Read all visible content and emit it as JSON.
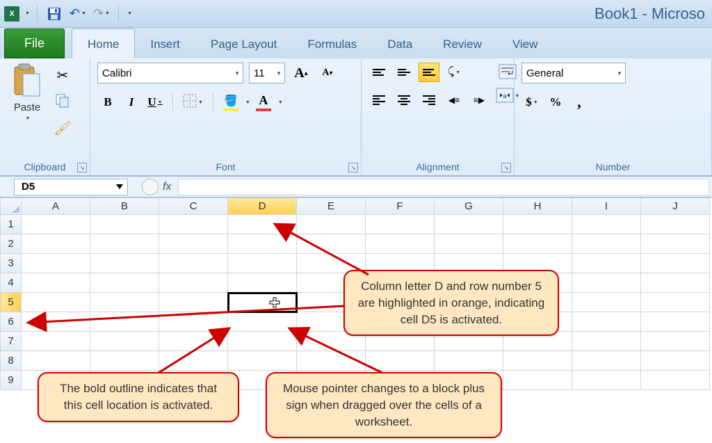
{
  "titlebar": {
    "title": "Book1 - Microso"
  },
  "tabs": {
    "file": "File",
    "home": "Home",
    "insert": "Insert",
    "pagelayout": "Page Layout",
    "formulas": "Formulas",
    "data": "Data",
    "review": "Review",
    "view": "View"
  },
  "ribbon": {
    "clipboard": {
      "label": "Clipboard",
      "paste": "Paste"
    },
    "font": {
      "label": "Font",
      "name": "Calibri",
      "size": "11",
      "bold": "B",
      "italic": "I",
      "underline": "U",
      "grow": "A",
      "shrink": "A"
    },
    "alignment": {
      "label": "Alignment"
    },
    "number": {
      "label": "Number",
      "format": "General",
      "currency": "$",
      "percent": "%",
      "comma": ","
    }
  },
  "formula_bar": {
    "name_box": "D5",
    "fx": "fx"
  },
  "grid": {
    "columns": [
      "A",
      "B",
      "C",
      "D",
      "E",
      "F",
      "G",
      "H",
      "I",
      "J"
    ],
    "rows": [
      "1",
      "2",
      "3",
      "4",
      "5",
      "6",
      "7",
      "8",
      "9"
    ],
    "active_col": "D",
    "active_row": "5"
  },
  "callouts": {
    "c1": "Column letter D and row number 5 are highlighted in orange, indicating cell D5 is activated.",
    "c2": "The bold outline indicates that this cell location is activated.",
    "c3": "Mouse pointer changes to a block plus sign when dragged over the cells of a worksheet."
  }
}
